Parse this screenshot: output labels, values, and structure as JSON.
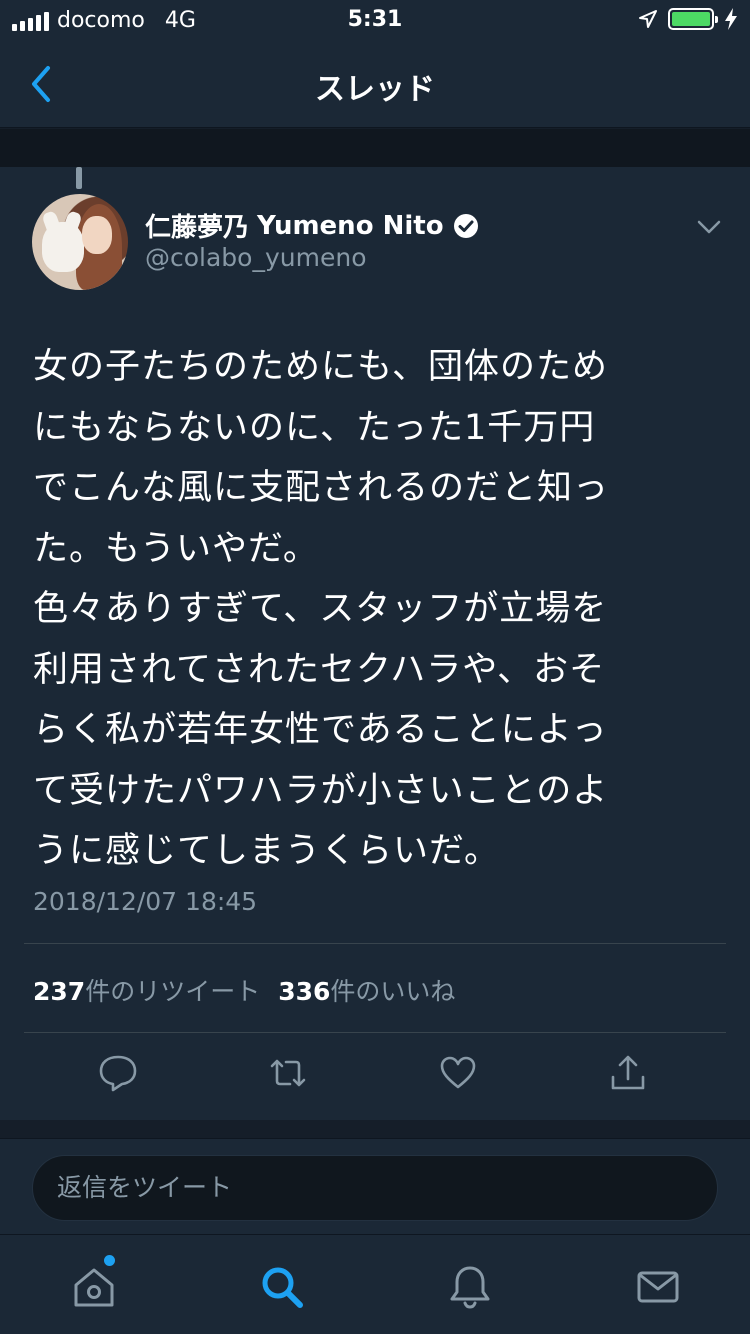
{
  "status_bar": {
    "carrier": "docomo",
    "network": "4G",
    "time": "5:31"
  },
  "nav": {
    "title": "スレッド"
  },
  "tweet": {
    "display_name": "仁藤夢乃",
    "display_name_en": "Yumeno Nito",
    "handle": "@colabo_yumeno",
    "text": "女の子たちのためにも、団体のため\nにもならないのに、たった1千万円\nでこんな風に支配されるのだと知っ\nた。もういやだ。\n色々ありすぎて、スタッフが立場を\n利用されてされたセクハラや、おそ\nらく私が若年女性であることによっ\nて受けたパワハラが小さいことのよ\nうに感じてしまうくらいだ。",
    "timestamp": "2018/12/07 18:45",
    "retweet_count": "237",
    "retweet_label": "件のリツイート",
    "like_count": "336",
    "like_label": "件のいいね"
  },
  "reply": {
    "placeholder": "返信をツイート"
  },
  "icons": {
    "reply": "reply-icon",
    "retweet": "retweet-icon",
    "like": "heart-icon",
    "share": "share-icon",
    "home": "home-icon",
    "search": "search-icon",
    "notifications": "bell-icon",
    "messages": "envelope-icon"
  },
  "colors": {
    "background": "#151e29",
    "surface": "#1b2836",
    "secondary_text": "#8899a6",
    "accent": "#1da1f2",
    "battery": "#4cd964"
  }
}
